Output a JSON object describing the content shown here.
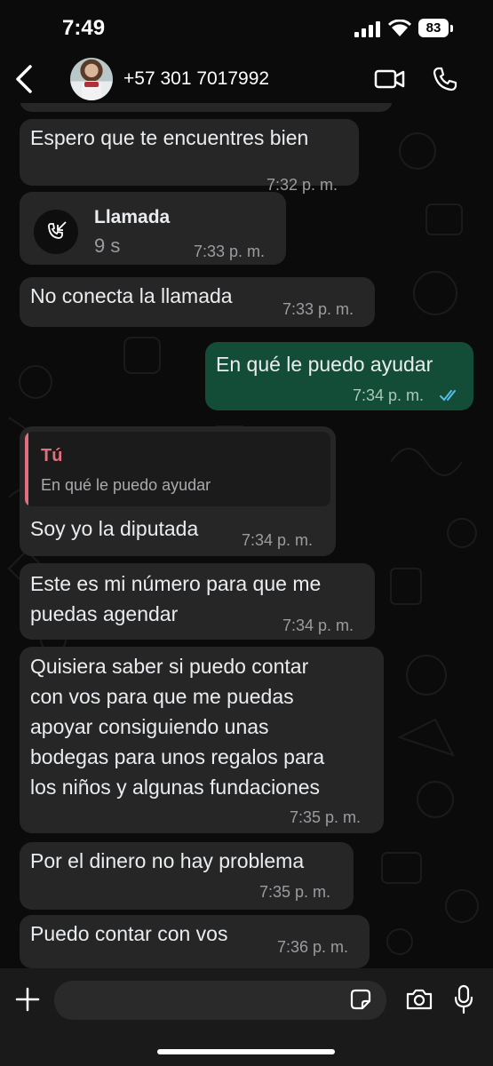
{
  "status_bar": {
    "time": "7:49",
    "battery": "83"
  },
  "header": {
    "contact_name": "+57 301 7017992"
  },
  "messages": [
    {
      "text": "Espero que te encuentres bien",
      "time": "7:32 p. m."
    },
    {
      "call_title": "Llamada",
      "call_duration": "9 s",
      "time": "7:33 p. m."
    },
    {
      "text": "No conecta la llamada",
      "time": "7:33 p. m."
    },
    {
      "text": "En qué le puedo ayudar",
      "time": "7:34 p. m."
    },
    {
      "quote_author": "Tú",
      "quote_text": "En qué le puedo ayudar",
      "text": "Soy yo la diputada",
      "time": "7:34 p. m."
    },
    {
      "text": "Este es mi número para que me\npuedas agendar",
      "time": "7:34 p. m."
    },
    {
      "text": "Quisiera saber si puedo contar\ncon vos para que me puedas\napoyar consiguiendo unas\nbodegas para unos regalos para\nlos niños y algunas fundaciones",
      "time": "7:35 p. m."
    },
    {
      "text": "Por el dinero no hay problema",
      "time": "7:35 p. m."
    },
    {
      "text": "Puedo contar con vos",
      "time": "7:36 p. m."
    }
  ],
  "input": {
    "value": ""
  },
  "colors": {
    "incoming": "#262626",
    "outgoing": "#144d37",
    "read_ticks": "#53bdeb",
    "quote_accent": "#e0707d"
  },
  "icons": [
    "back-icon",
    "video-call-icon",
    "phone-icon",
    "missed-call-icon",
    "plus-icon",
    "sticker-icon",
    "camera-icon",
    "mic-icon"
  ]
}
